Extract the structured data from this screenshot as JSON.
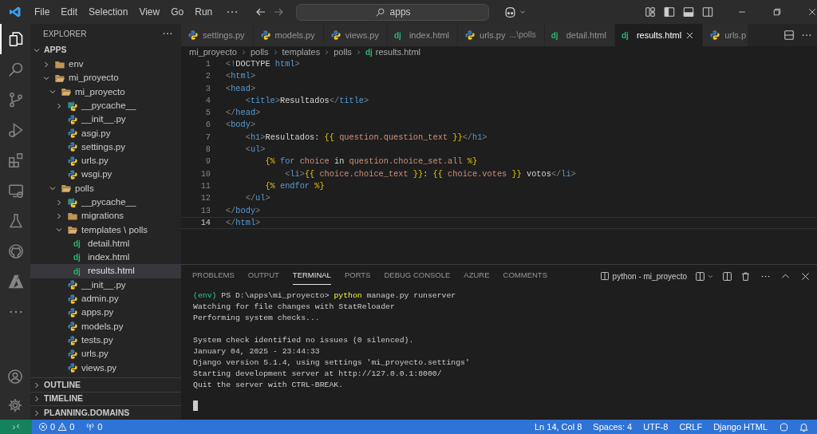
{
  "title_bar": {
    "menu": [
      "File",
      "Edit",
      "Selection",
      "View",
      "Go",
      "Run"
    ],
    "search": "apps"
  },
  "activity_bar": [
    {
      "kind": "files",
      "selected": true
    },
    {
      "kind": "search",
      "selected": false
    },
    {
      "kind": "source-control",
      "selected": false
    },
    {
      "kind": "run",
      "selected": false
    },
    {
      "kind": "extensions",
      "selected": false
    },
    {
      "kind": "remote",
      "selected": false
    },
    {
      "kind": "testing",
      "selected": false
    },
    {
      "kind": "github",
      "selected": false
    },
    {
      "kind": "azure",
      "selected": false
    },
    {
      "kind": "more",
      "selected": false
    }
  ],
  "sidebar": {
    "title": "EXPLORER",
    "root": {
      "label": "APPS",
      "expanded": true
    },
    "tree": [
      {
        "label": "env",
        "kind": "folder",
        "expanded": false,
        "selected": false
      },
      {
        "label": "mi_proyecto",
        "kind": "folder",
        "expanded": true,
        "selected": false,
        "children": [
          {
            "label": "mi_proyecto",
            "kind": "folder",
            "expanded": true,
            "selected": false,
            "children": [
              {
                "label": "__pycache__",
                "kind": "pycache",
                "expanded": false,
                "selected": false
              },
              {
                "label": "__init__.py",
                "kind": "python",
                "selected": false
              },
              {
                "label": "asgi.py",
                "kind": "python",
                "selected": false
              },
              {
                "label": "settings.py",
                "kind": "python",
                "selected": false
              },
              {
                "label": "urls.py",
                "kind": "python",
                "selected": false
              },
              {
                "label": "wsgi.py",
                "kind": "python",
                "selected": false
              }
            ]
          },
          {
            "label": "polls",
            "kind": "folder",
            "expanded": true,
            "selected": false,
            "children": [
              {
                "label": "__pycache__",
                "kind": "pycache",
                "expanded": false,
                "selected": false
              },
              {
                "label": "migrations",
                "kind": "folder",
                "expanded": false,
                "selected": false
              },
              {
                "label": "templates \\ polls",
                "kind": "folder",
                "expanded": true,
                "selected": false,
                "children": [
                  {
                    "label": "detail.html",
                    "kind": "django",
                    "badge": "dj",
                    "selected": false
                  },
                  {
                    "label": "index.html",
                    "kind": "django",
                    "badge": "dj",
                    "selected": false
                  },
                  {
                    "label": "results.html",
                    "kind": "django",
                    "badge": "dj",
                    "selected": true
                  }
                ]
              },
              {
                "label": "__init__.py",
                "kind": "python",
                "selected": false
              },
              {
                "label": "admin.py",
                "kind": "python",
                "selected": false
              },
              {
                "label": "apps.py",
                "kind": "python",
                "selected": false
              },
              {
                "label": "models.py",
                "kind": "python",
                "selected": false
              },
              {
                "label": "tests.py",
                "kind": "python",
                "selected": false
              },
              {
                "label": "urls.py",
                "kind": "python",
                "selected": false
              },
              {
                "label": "views.py",
                "kind": "python",
                "selected": false
              }
            ]
          }
        ]
      }
    ],
    "sections": [
      {
        "label": "OUTLINE",
        "expanded": false
      },
      {
        "label": "TIMELINE",
        "expanded": false
      },
      {
        "label": "PLANNING.DOMAINS",
        "expanded": false
      }
    ]
  },
  "tabs": [
    {
      "label": "settings.py",
      "kind": "python",
      "selected": false
    },
    {
      "label": "models.py",
      "kind": "python",
      "selected": false
    },
    {
      "label": "views.py",
      "kind": "python",
      "selected": false
    },
    {
      "label": "index.html",
      "kind": "django",
      "badge": "dj",
      "selected": false
    },
    {
      "label": "urls.py",
      "description": "...\\polls",
      "kind": "python",
      "selected": false
    },
    {
      "label": "detail.html",
      "kind": "django",
      "badge": "dj",
      "selected": false
    },
    {
      "label": "results.html",
      "kind": "django",
      "badge": "dj",
      "selected": true
    },
    {
      "label": "urls.p",
      "kind": "python",
      "selected": false
    }
  ],
  "breadcrumbs": [
    {
      "label": "mi_proyecto"
    },
    {
      "label": "polls"
    },
    {
      "label": "templates"
    },
    {
      "label": "polls"
    },
    {
      "label": "results.html",
      "badge": "dj"
    }
  ],
  "editor": {
    "lines": [
      {
        "number": "1",
        "current": false,
        "tokens": [
          {
            "kind": "punct",
            "text": "<!"
          },
          {
            "kind": "text",
            "text": "DOCTYPE"
          },
          {
            "kind": "tag",
            "text": " html"
          },
          {
            "kind": "punct",
            "text": ">"
          }
        ]
      },
      {
        "number": "2",
        "current": false,
        "tokens": [
          {
            "kind": "punct",
            "text": "<"
          },
          {
            "kind": "tag",
            "text": "html"
          },
          {
            "kind": "punct",
            "text": ">"
          }
        ]
      },
      {
        "number": "3",
        "current": false,
        "tokens": [
          {
            "kind": "punct",
            "text": "<"
          },
          {
            "kind": "tag",
            "text": "head"
          },
          {
            "kind": "punct",
            "text": ">"
          }
        ]
      },
      {
        "number": "4",
        "current": false,
        "tokens": [
          {
            "kind": "punct",
            "text": "    <"
          },
          {
            "kind": "tag",
            "text": "title"
          },
          {
            "kind": "punct",
            "text": ">"
          },
          {
            "kind": "text",
            "text": "Resultados"
          },
          {
            "kind": "punct",
            "text": "</"
          },
          {
            "kind": "tag",
            "text": "title"
          },
          {
            "kind": "punct",
            "text": ">"
          }
        ]
      },
      {
        "number": "5",
        "current": false,
        "tokens": [
          {
            "kind": "punct",
            "text": "</"
          },
          {
            "kind": "tag",
            "text": "head"
          },
          {
            "kind": "punct",
            "text": ">"
          }
        ]
      },
      {
        "number": "6",
        "current": false,
        "tokens": [
          {
            "kind": "punct",
            "text": "<"
          },
          {
            "kind": "tag",
            "text": "body"
          },
          {
            "kind": "punct",
            "text": ">"
          }
        ]
      },
      {
        "number": "7",
        "current": false,
        "tokens": [
          {
            "kind": "punct",
            "text": "    <"
          },
          {
            "kind": "tag",
            "text": "h1"
          },
          {
            "kind": "punct",
            "text": ">"
          },
          {
            "kind": "text",
            "text": "Resultados: "
          },
          {
            "kind": "delim",
            "text": "{{"
          },
          {
            "kind": "var",
            "text": " question.question_text "
          },
          {
            "kind": "delim",
            "text": "}}"
          },
          {
            "kind": "punct",
            "text": "</"
          },
          {
            "kind": "tag",
            "text": "h1"
          },
          {
            "kind": "punct",
            "text": ">"
          }
        ]
      },
      {
        "number": "8",
        "current": false,
        "tokens": [
          {
            "kind": "punct",
            "text": "    <"
          },
          {
            "kind": "tag",
            "text": "ul"
          },
          {
            "kind": "punct",
            "text": ">"
          }
        ]
      },
      {
        "number": "9",
        "current": false,
        "tokens": [
          {
            "kind": "delim",
            "text": "        {%"
          },
          {
            "kind": "keyword",
            "text": " for"
          },
          {
            "kind": "var",
            "text": " choice"
          },
          {
            "kind": "text",
            "text": " in"
          },
          {
            "kind": "var",
            "text": " question.choice_set.all"
          },
          {
            "kind": "delim",
            "text": " %}"
          }
        ]
      },
      {
        "number": "10",
        "current": false,
        "tokens": [
          {
            "kind": "punct",
            "text": "            <"
          },
          {
            "kind": "tag",
            "text": "li"
          },
          {
            "kind": "punct",
            "text": ">"
          },
          {
            "kind": "delim",
            "text": "{{"
          },
          {
            "kind": "var",
            "text": " choice.choice_text "
          },
          {
            "kind": "delim",
            "text": "}}"
          },
          {
            "kind": "text",
            "text": ": "
          },
          {
            "kind": "delim",
            "text": "{{"
          },
          {
            "kind": "var",
            "text": " choice.votes "
          },
          {
            "kind": "delim",
            "text": "}}"
          },
          {
            "kind": "text",
            "text": " votos"
          },
          {
            "kind": "punct",
            "text": "</"
          },
          {
            "kind": "tag",
            "text": "li"
          },
          {
            "kind": "punct",
            "text": ">"
          }
        ]
      },
      {
        "number": "11",
        "current": false,
        "tokens": [
          {
            "kind": "delim",
            "text": "        {%"
          },
          {
            "kind": "keyword",
            "text": " endfor"
          },
          {
            "kind": "delim",
            "text": " %}"
          }
        ]
      },
      {
        "number": "12",
        "current": false,
        "tokens": [
          {
            "kind": "punct",
            "text": "    </"
          },
          {
            "kind": "tag",
            "text": "ul"
          },
          {
            "kind": "punct",
            "text": ">"
          }
        ]
      },
      {
        "number": "13",
        "current": false,
        "tokens": [
          {
            "kind": "punct",
            "text": "</"
          },
          {
            "kind": "tag",
            "text": "body"
          },
          {
            "kind": "punct",
            "text": ">"
          }
        ]
      },
      {
        "number": "14",
        "current": true,
        "tokens": [
          {
            "kind": "punct",
            "text": "</"
          },
          {
            "kind": "tag",
            "text": "html"
          },
          {
            "kind": "punct",
            "text": ">"
          }
        ]
      }
    ]
  },
  "panel": {
    "tabs": [
      {
        "label": "PROBLEMS",
        "selected": false
      },
      {
        "label": "OUTPUT",
        "selected": false
      },
      {
        "label": "TERMINAL",
        "selected": true
      },
      {
        "label": "PORTS",
        "selected": false
      },
      {
        "label": "DEBUG CONSOLE",
        "selected": false
      },
      {
        "label": "AZURE",
        "selected": false
      },
      {
        "label": "COMMENTS",
        "selected": false
      }
    ],
    "terminal_name": "python - mi_proyecto",
    "blocks": [
      [
        {
          "tokens": [
            {
              "kind": "env",
              "text": "(env)"
            },
            {
              "kind": "text",
              "text": " PS D:\\apps\\mi_proyecto> "
            },
            {
              "kind": "command",
              "text": "python"
            },
            {
              "kind": "text",
              "text": " manage.py runserver"
            }
          ]
        },
        {
          "tokens": [
            {
              "kind": "text",
              "text": "Watching for file changes with StatReloader"
            }
          ]
        },
        {
          "tokens": [
            {
              "kind": "text",
              "text": "Performing system checks..."
            }
          ]
        }
      ],
      [
        {
          "tokens": [
            {
              "kind": "text",
              "text": "System check identified no issues (0 silenced)."
            }
          ]
        },
        {
          "tokens": [
            {
              "kind": "text",
              "text": "January 04, 2025 - 23:44:33"
            }
          ]
        },
        {
          "tokens": [
            {
              "kind": "text",
              "text": "Django version 5.1.4, using settings 'mi_proyecto.settings'"
            }
          ]
        },
        {
          "tokens": [
            {
              "kind": "text",
              "text": "Starting development server at http://127.0.0.1:8000/"
            }
          ]
        },
        {
          "tokens": [
            {
              "kind": "text",
              "text": "Quit the server with CTRL-BREAK."
            }
          ]
        }
      ]
    ]
  },
  "status_bar": {
    "errors": "0",
    "warnings": "0",
    "ports": "0",
    "items": [
      "Ln 14, Col 8",
      "Spaces: 4",
      "UTF-8",
      "CRLF",
      "Django HTML"
    ]
  }
}
